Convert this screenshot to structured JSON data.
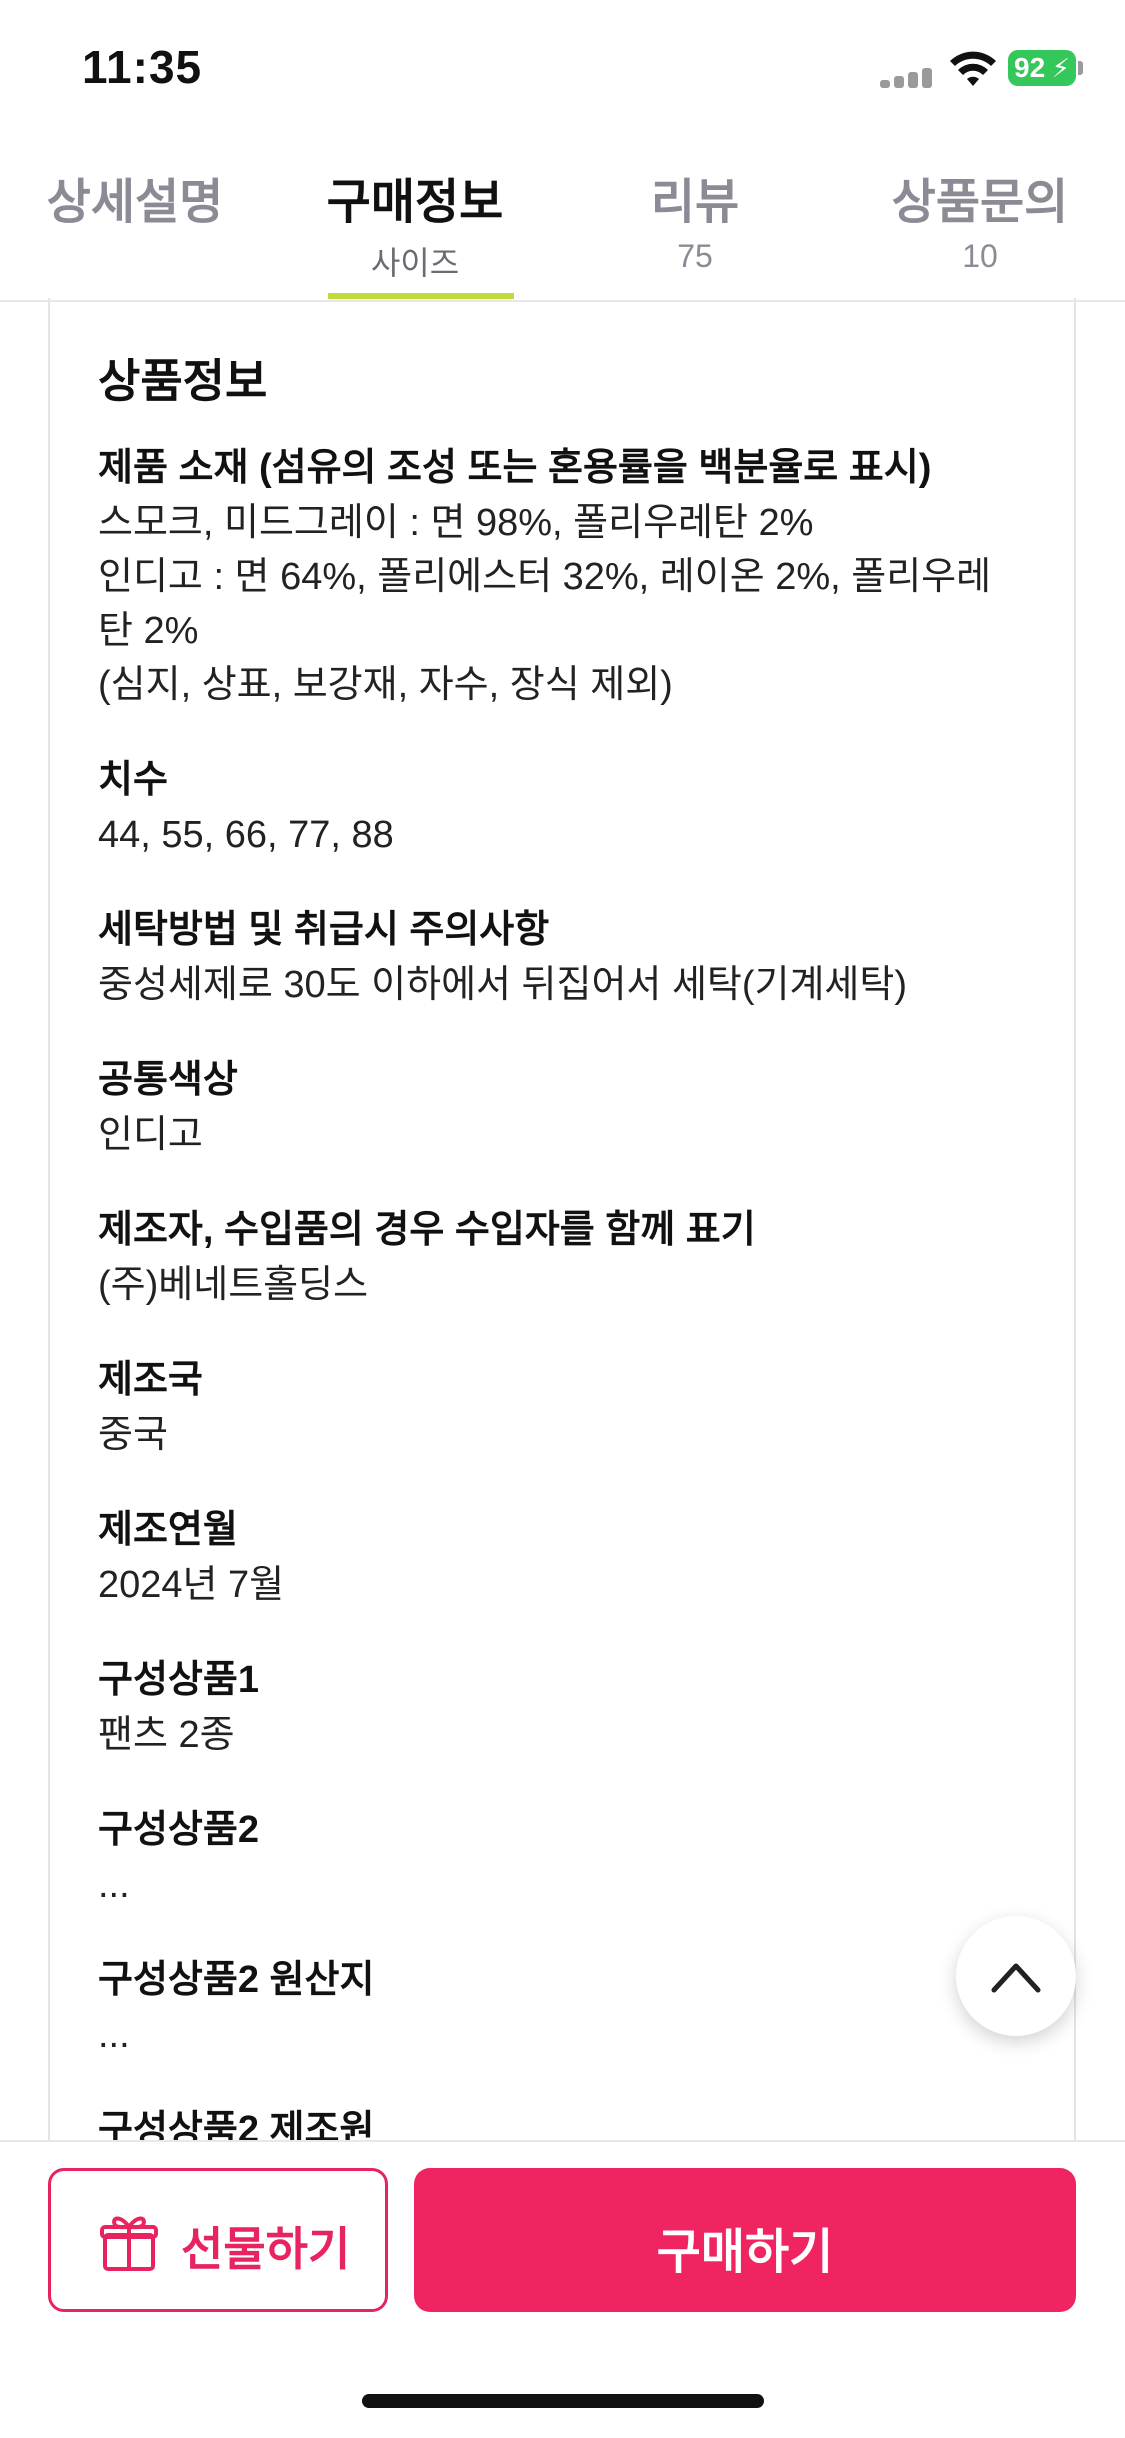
{
  "status_bar": {
    "time": "11:35",
    "battery": "92"
  },
  "tabs": [
    {
      "label": "상세설명",
      "sub": ""
    },
    {
      "label": "구매정보",
      "sub": "사이즈"
    },
    {
      "label": "리뷰",
      "sub": "75"
    },
    {
      "label": "상품문의",
      "sub": "10"
    }
  ],
  "active_tab": "구매정보",
  "card": {
    "title": "상품정보",
    "sections": [
      {
        "title": "제품 소재 (섬유의 조성 또는 혼용률을 백분율로 표시)",
        "value": "스모크, 미드그레이 : 면 98%, 폴리우레탄 2%\n인디고 : 면 64%, 폴리에스터 32%, 레이온 2%, 폴리우레\n탄 2%\n(심지, 상표, 보강재, 자수, 장식 제외)"
      },
      {
        "title": "치수",
        "value": "44, 55, 66, 77, 88"
      },
      {
        "title": "세탁방법 및 취급시 주의사항",
        "value": "중성세제로 30도 이하에서 뒤집어서 세탁(기계세탁)"
      },
      {
        "title": "공통색상",
        "value": "인디고"
      },
      {
        "title": "제조자, 수입품의 경우 수입자를 함께 표기",
        "value": "(주)베네트홀딩스"
      },
      {
        "title": "제조국",
        "value": "중국"
      },
      {
        "title": "제조연월",
        "value": "2024년 7월"
      },
      {
        "title": "구성상품1",
        "value": "팬츠 2종"
      },
      {
        "title": "구성상품2",
        "value": "..."
      },
      {
        "title": "구성상품2 원산지",
        "value": "..."
      },
      {
        "title": "구성상품2 제조원",
        "value": ""
      }
    ]
  },
  "bottom_bar": {
    "gift_label": "선물하기",
    "buy_label": "구매하기"
  },
  "colors": {
    "accent": "#ef2460",
    "tab_indicator": "#c2d93a",
    "battery": "#34c759"
  },
  "icons": [
    "signal-icon",
    "wifi-icon",
    "battery-icon",
    "chevron-up-icon",
    "gift-icon"
  ]
}
